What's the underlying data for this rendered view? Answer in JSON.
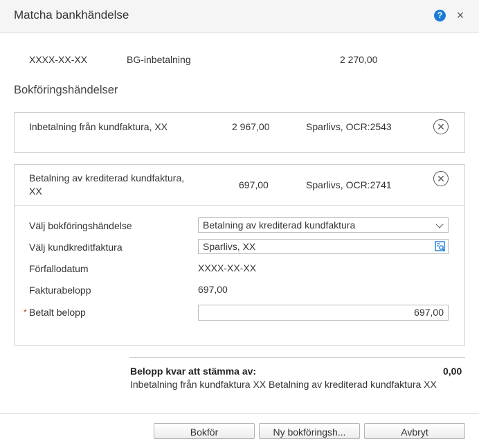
{
  "dialog": {
    "title": "Matcha bankhändelse",
    "help_icon": "?",
    "close_icon": "×"
  },
  "transaction": {
    "date": "XXXX-XX-XX",
    "type": "BG-inbetalning",
    "amount": "2 270,00"
  },
  "section_title": "Bokföringshändelser",
  "events": [
    {
      "description": "Inbetalning från kundfaktura,  XX",
      "amount": "2 967,00",
      "reference": "Sparlivs, OCR:2543"
    },
    {
      "description_line1": "Betalning av krediterad kundfaktura,",
      "description_line2": "XX",
      "amount": "697,00",
      "reference": "Sparlivs, OCR:2741"
    }
  ],
  "form": {
    "event_label": "Välj bokföringshändelse",
    "event_value": "Betalning av krediterad kundfaktura",
    "credit_invoice_label": "Välj kundkreditfaktura",
    "credit_invoice_value": "Sparlivs, XX",
    "due_date_label": "Förfallodatum",
    "due_date_value": "XXXX-XX-XX",
    "invoice_amount_label": "Fakturabelopp",
    "invoice_amount_value": "697,00",
    "paid_amount_required": "*",
    "paid_amount_label": "Betalt belopp",
    "paid_amount_value": "697,00"
  },
  "remaining": {
    "label": "Belopp kvar att stämma av:",
    "value": "0,00",
    "note": "Inbetalning från kundfaktura XX Betalning av krediterad kundfaktura XX"
  },
  "buttons": {
    "book": "Bokför",
    "new_event": "Ny bokföringsh...",
    "cancel": "Avbryt"
  },
  "colors": {
    "accent": "#1c7ad6",
    "required": "#c0392b"
  }
}
